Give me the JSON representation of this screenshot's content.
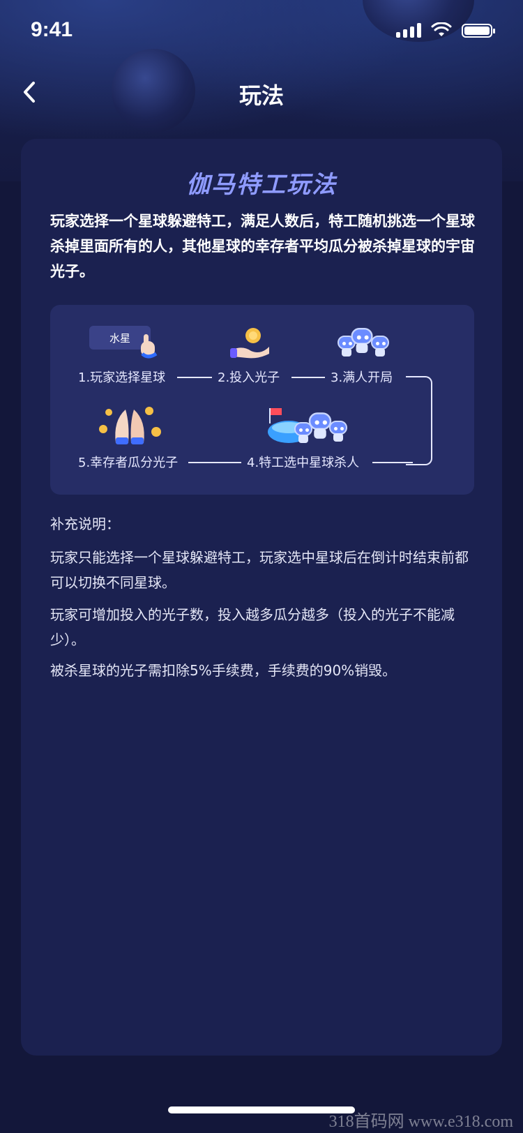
{
  "status": {
    "time": "9:41"
  },
  "nav": {
    "title": "玩法"
  },
  "card": {
    "title": "伽马特工玩法",
    "intro": "玩家选择一个星球躲避特工，满足人数后，特工随机挑选一个星球杀掉里面所有的人，其他星球的幸存者平均瓜分被杀掉星球的宇宙光子。"
  },
  "flow": {
    "tag": "水星",
    "steps": [
      "1.玩家选择星球",
      "2.投入光子",
      "3.满人开局",
      "4.特工选中星球杀人",
      "5.幸存者瓜分光子"
    ]
  },
  "notes": {
    "heading": "补充说明：",
    "items": [
      "玩家只能选择一个星球躲避特工，玩家选中星球后在倒计时结束前都可以切换不同星球。",
      "玩家可增加投入的光子数，投入越多瓜分越多（投入的光子不能减少）。",
      "被杀星球的光子需扣除5%手续费，手续费的90%销毁。"
    ]
  },
  "watermark": "318首码网  www.e318.com",
  "colors": {
    "background": "#13173a",
    "card": "#1b2150",
    "flow_panel": "#262d66",
    "title_accent": "#8f9bff"
  }
}
